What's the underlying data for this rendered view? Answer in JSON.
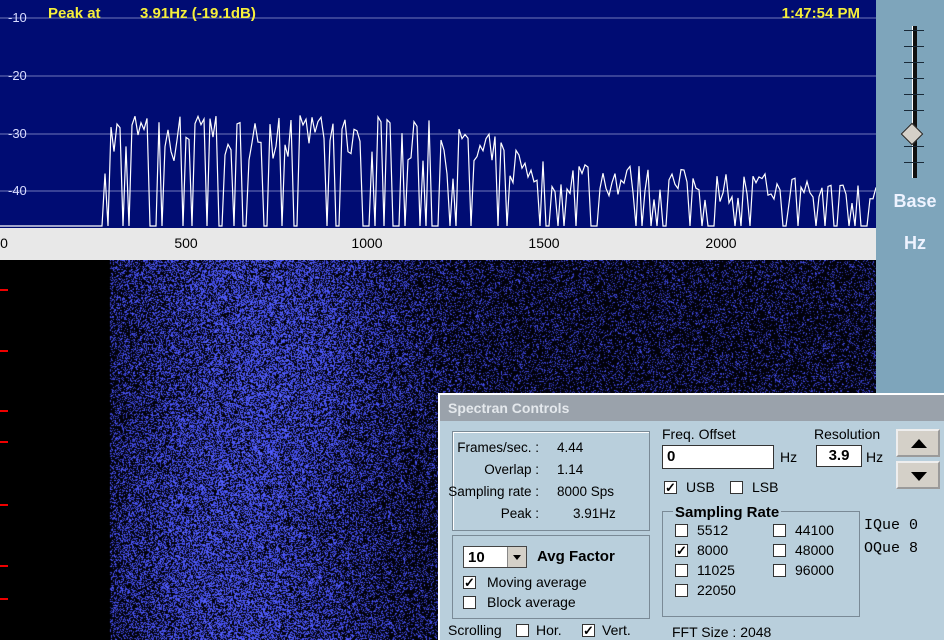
{
  "spectrum": {
    "peak_label": "Peak at",
    "peak_value": "3.91Hz (-19.1dB)",
    "clock": "1:47:54 PM",
    "db_labels": [
      "-10",
      "-20",
      "-30",
      "-40"
    ],
    "freq_labels": [
      "0",
      "500",
      "1000",
      "1500",
      "2000"
    ],
    "background_color": "#000c73",
    "trace_color": "#ffffff",
    "readout_color": "#f5ef3a"
  },
  "side_panel": {
    "slider_label": "Base",
    "slider_unit": "Hz"
  },
  "controls": {
    "title": "Spectran Controls",
    "stats": {
      "frames_label": "Frames/sec. :",
      "frames_value": "4.44",
      "overlap_label": "Overlap :",
      "overlap_value": "1.14",
      "rate_label": "Sampling rate :",
      "rate_value": "8000 Sps",
      "peak_label": "Peak :",
      "peak_value": "3.91Hz"
    },
    "freq_offset": {
      "label": "Freq. Offset",
      "value": "0",
      "unit": "Hz"
    },
    "resolution": {
      "label": "Resolution",
      "value": "3.9",
      "unit": "Hz"
    },
    "usb": {
      "label": "USB",
      "checked": true
    },
    "lsb": {
      "label": "LSB",
      "checked": false
    },
    "avg": {
      "value": "10",
      "label": "Avg Factor",
      "moving_label": "Moving average",
      "moving_checked": true,
      "block_label": "Block average",
      "block_checked": false
    },
    "sampling": {
      "title": "Sampling Rate",
      "rates": [
        {
          "label": "5512",
          "checked": false
        },
        {
          "label": "8000",
          "checked": true
        },
        {
          "label": "11025",
          "checked": false
        },
        {
          "label": "22050",
          "checked": false
        },
        {
          "label": "44100",
          "checked": false
        },
        {
          "label": "48000",
          "checked": false
        },
        {
          "label": "96000",
          "checked": false
        }
      ]
    },
    "que": {
      "in_label": "IQue",
      "in_value": "0",
      "out_label": "OQue",
      "out_value": "8"
    },
    "scrolling": {
      "label": "Scrolling",
      "hor_label": "Hor.",
      "hor_checked": false,
      "vert_label": "Vert.",
      "vert_checked": true
    },
    "fft": {
      "label": "FFT Size :",
      "value": "2048"
    }
  }
}
